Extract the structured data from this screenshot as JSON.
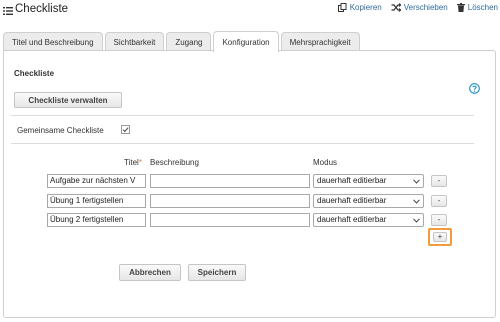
{
  "header": {
    "title": "Checkliste",
    "title_icon": "list-icon",
    "actions": [
      {
        "label": "Kopieren",
        "icon": "copy-icon"
      },
      {
        "label": "Verschieben",
        "icon": "move-icon"
      },
      {
        "label": "Löschen",
        "icon": "trash-icon"
      }
    ]
  },
  "tabs": [
    {
      "label": "Titel und Beschreibung",
      "active": false
    },
    {
      "label": "Sichtbarkeit",
      "active": false
    },
    {
      "label": "Zugang",
      "active": false
    },
    {
      "label": "Konfiguration",
      "active": true
    },
    {
      "label": "Mehrsprachigkeit",
      "active": false
    }
  ],
  "config": {
    "section_title": "Checkliste",
    "manage_button": "Checkliste verwalten",
    "help_icon": "help-icon",
    "shared_label": "Gemeinsame Checkliste",
    "shared_checked": true
  },
  "table": {
    "headers": {
      "title": "Titel",
      "required_marker": "*",
      "description": "Beschreibung",
      "mode": "Modus"
    },
    "rows": [
      {
        "title": "Aufgabe zur nächsten V",
        "description": "",
        "mode": "dauerhaft editierbar",
        "remove": "-"
      },
      {
        "title": "Übung 1 fertigstellen",
        "description": "",
        "mode": "dauerhaft editierbar",
        "remove": "-"
      },
      {
        "title": "Übung 2 fertigstellen",
        "description": "",
        "mode": "dauerhaft editierbar",
        "remove": "-"
      }
    ],
    "add_label": "+"
  },
  "buttons": {
    "cancel": "Abbrechen",
    "save": "Speichern"
  },
  "colors": {
    "link": "#2e6a9a",
    "help": "#1f8fc0",
    "required": "#e87b2c",
    "highlight": "#f39c3c"
  }
}
